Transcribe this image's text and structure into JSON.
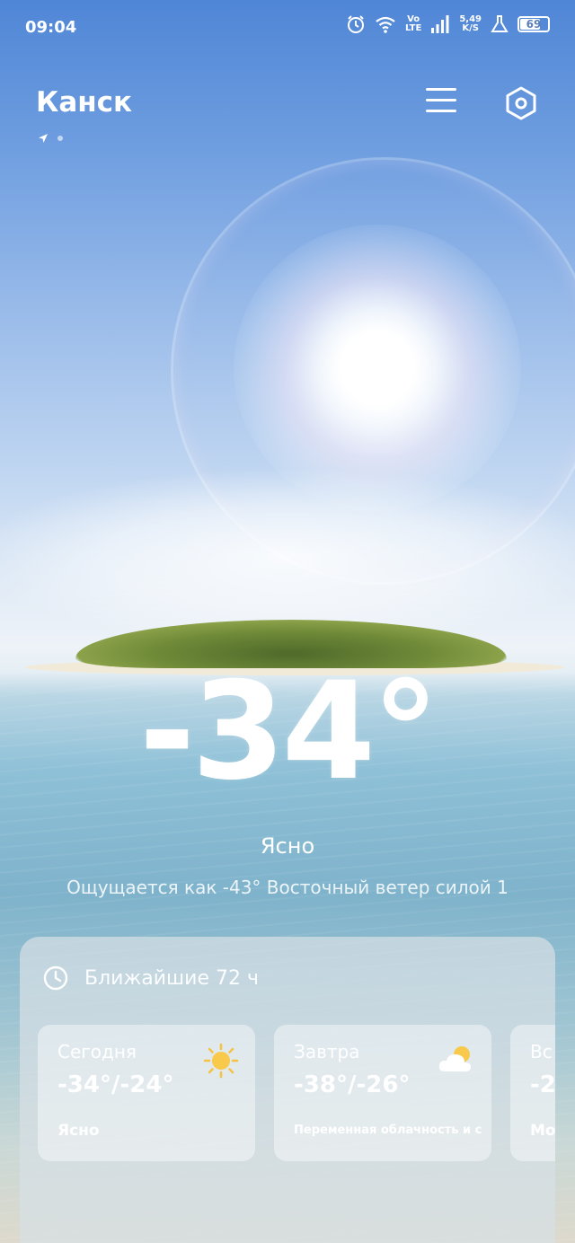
{
  "status_bar": {
    "time": "09:04",
    "volte_top": "Vo",
    "volte_bottom": "LTE",
    "speed_top": "5,49",
    "speed_bottom": "K/S",
    "battery": "69",
    "icons": [
      "alarm-icon",
      "wifi-icon",
      "volte-icon",
      "signal-icon",
      "speed-indicator",
      "lab-flask-icon",
      "battery-icon"
    ]
  },
  "header": {
    "city": "Канск",
    "menu_icon": "hamburger-menu-icon",
    "settings_icon": "hexagon-settings-icon"
  },
  "current": {
    "temperature": "-34°",
    "condition": "Ясно",
    "feels_like": "Ощущается как  -43°  Восточный ветер силой 1"
  },
  "forecast": {
    "title": "Ближайшие 72 ч",
    "days": [
      {
        "name": "Сегодня",
        "temp": "-34°/-24°",
        "desc": "Ясно",
        "icon": "sun-icon"
      },
      {
        "name": "Завтра",
        "temp": "-38°/-26°",
        "desc": "Переменная облачность и солн...",
        "icon": "partly-cloudy-icon"
      },
      {
        "name": "Вс",
        "temp": "-2",
        "desc": "Мо",
        "icon": ""
      }
    ]
  },
  "colors": {
    "sky_top": "#4f86d6",
    "sea": "#7fb3cb",
    "text": "#ffffff"
  }
}
